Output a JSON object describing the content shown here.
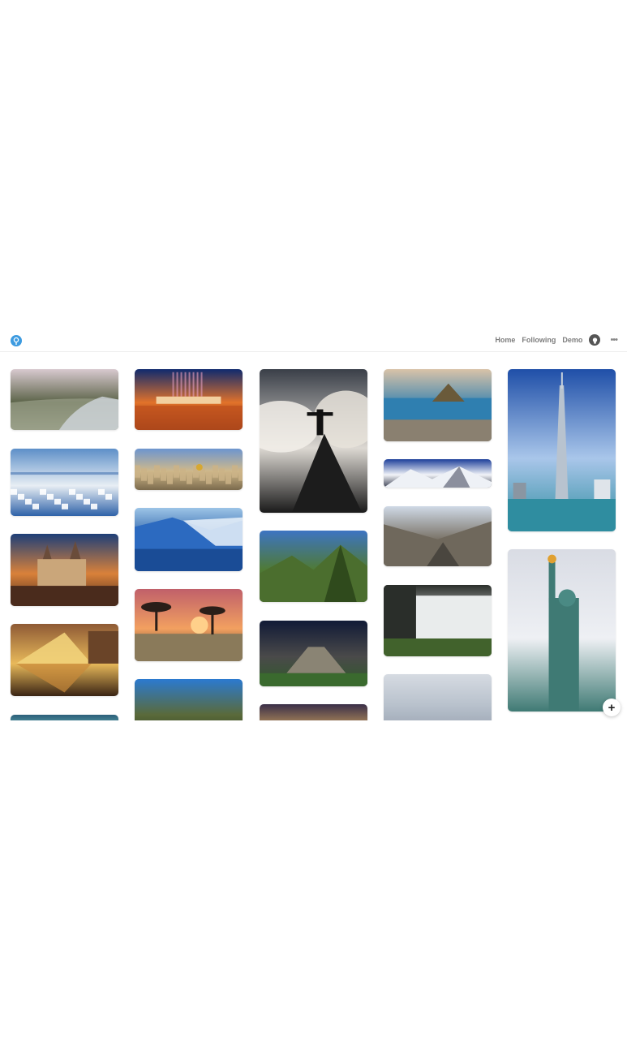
{
  "header": {
    "logo_icon": "pin-logo-icon",
    "nav": {
      "home": "Home",
      "following": "Following",
      "demo": "Demo"
    },
    "github_icon": "github-icon",
    "more_label": "•••"
  },
  "fab": {
    "label": "+"
  },
  "columns": [
    [
      {
        "name": "pin-cherry-blossom-canal",
        "colors": [
          "#d8c9cf",
          "#5b6348",
          "#9aa089"
        ],
        "scene": "canal"
      },
      {
        "name": "pin-santorini",
        "colors": [
          "#5d8fc8",
          "#e8eef4",
          "#2f62a8"
        ],
        "scene": "town"
      },
      {
        "name": "pin-neuschwanstein-castle",
        "colors": [
          "#1e3f78",
          "#d9813a",
          "#4a2b1c"
        ],
        "scene": "castle"
      },
      {
        "name": "pin-louvre-pyramid",
        "colors": [
          "#8e5a35",
          "#e8b95a",
          "#3a2414"
        ],
        "scene": "pyramid"
      },
      {
        "name": "pin-lagoon",
        "colors": [
          "#2c5f7a",
          "#6fc1bf",
          "#163242"
        ],
        "scene": "plain"
      }
    ],
    [
      {
        "name": "pin-potala-palace-fountains",
        "colors": [
          "#0f2a6e",
          "#e2722a",
          "#5a1a0e"
        ],
        "scene": "night"
      },
      {
        "name": "pin-jerusalem-city",
        "colors": [
          "#6d95cf",
          "#d0b98a",
          "#7b6a4c"
        ],
        "scene": "city"
      },
      {
        "name": "pin-glacier",
        "colors": [
          "#9cc4e6",
          "#1d54a3",
          "#0d2a5c"
        ],
        "scene": "ice"
      },
      {
        "name": "pin-savanna-sunset",
        "colors": [
          "#c0606a",
          "#f2a060",
          "#3b2a22"
        ],
        "scene": "savanna"
      },
      {
        "name": "pin-statue-hand",
        "colors": [
          "#2b7ad0",
          "#5a6a3a",
          "#2a3a1f"
        ],
        "scene": "plain"
      }
    ],
    [
      {
        "name": "pin-christ-the-redeemer",
        "colors": [
          "#3a3f48",
          "#dcd8d2",
          "#1a1a1a"
        ],
        "scene": "clouds"
      },
      {
        "name": "pin-machu-picchu",
        "colors": [
          "#3d74c2",
          "#4f7a35",
          "#2b4a1e"
        ],
        "scene": "mountains"
      },
      {
        "name": "pin-chichen-itza",
        "colors": [
          "#111a36",
          "#4a4a4a",
          "#2f5a2a"
        ],
        "scene": "temple"
      },
      {
        "name": "pin-sunset-glow",
        "colors": [
          "#3a2f48",
          "#e0b060",
          "#4a3a3a"
        ],
        "scene": "plain"
      }
    ],
    [
      {
        "name": "pin-rio-de-janeiro",
        "colors": [
          "#d9c3a8",
          "#2f7fb0",
          "#6a5a3a"
        ],
        "scene": "bay"
      },
      {
        "name": "pin-himalaya",
        "colors": [
          "#1d3f9a",
          "#f2f4f8",
          "#3a3f52"
        ],
        "scene": "snow"
      },
      {
        "name": "pin-volcano-valley",
        "colors": [
          "#cfd9e6",
          "#7a7368",
          "#4e4a44"
        ],
        "scene": "valley"
      },
      {
        "name": "pin-victoria-falls",
        "colors": [
          "#2a2e2a",
          "#e9ecec",
          "#41622c"
        ],
        "scene": "falls"
      },
      {
        "name": "pin-cloudy-sky",
        "colors": [
          "#d6dbe2",
          "#b8c1cc",
          "#9aa4b2"
        ],
        "scene": "plain"
      }
    ],
    [
      {
        "name": "pin-burj-khalifa",
        "colors": [
          "#1f4fa8",
          "#a9c6ea",
          "#2f8da0"
        ],
        "scene": "tower"
      },
      {
        "name": "pin-statue-of-liberty",
        "colors": [
          "#d9dce4",
          "#eef0f4",
          "#3f7a74"
        ],
        "scene": "liberty"
      }
    ]
  ]
}
